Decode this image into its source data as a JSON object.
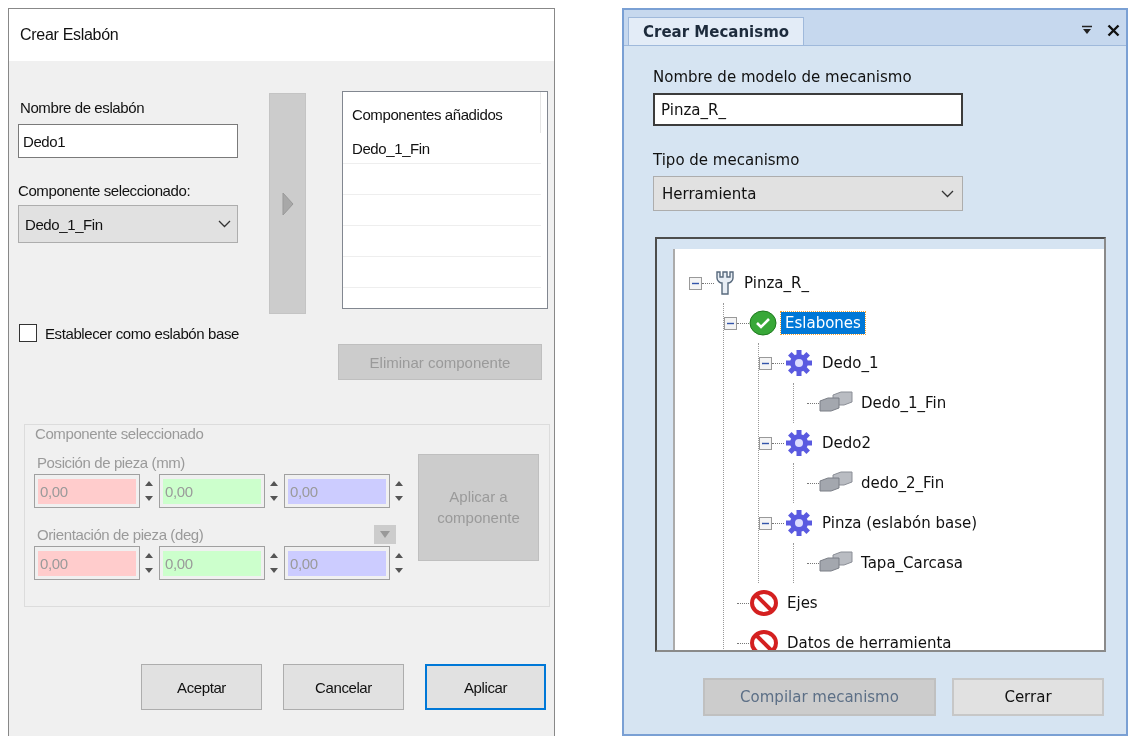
{
  "link_dialog": {
    "title": "Crear Eslabón",
    "name_label": "Nombre de eslabón",
    "name_value": "Dedo1",
    "component_label": "Componente seleccionado:",
    "component_value": "Dedo_1_Fin",
    "added_list": {
      "header": "Componentes añadidos",
      "rows": [
        "Dedo_1_Fin"
      ]
    },
    "base_checkbox": {
      "label": "Establecer como eslabón base",
      "checked": false
    },
    "remove_button": {
      "label": "Eliminar componente",
      "disabled": true
    },
    "group": {
      "title": "Componente seleccionado",
      "disabled": true,
      "position": {
        "label": "Posición de pieza (mm)",
        "fields": [
          {
            "value": "0,00",
            "color": "#ffcccc"
          },
          {
            "value": "0,00",
            "color": "#ccffcc"
          },
          {
            "value": "0,00",
            "color": "#ccccff"
          }
        ]
      },
      "orientation": {
        "label": "Orientación de pieza (deg)",
        "fields": [
          {
            "value": "0,00",
            "color": "#ffcccc"
          },
          {
            "value": "0,00",
            "color": "#ccffcc"
          },
          {
            "value": "0,00",
            "color": "#ccccff"
          }
        ]
      },
      "apply_button": "Aplicar a componente"
    },
    "buttons": [
      {
        "label": "Aceptar",
        "selected": false
      },
      {
        "label": "Cancelar",
        "selected": false
      },
      {
        "label": "Aplicar",
        "selected": true
      }
    ]
  },
  "mechanism_panel": {
    "tab": "Crear Mecanismo",
    "name_label": "Nombre de modelo de mecanismo",
    "name_value": "Pinza_R_",
    "type_label": "Tipo de mecanismo",
    "type_value": "Herramienta",
    "tree": [
      {
        "label": "Pinza_R_",
        "kind": "tool",
        "expanded": true,
        "selected": false,
        "children": [
          {
            "label": "Eslabones",
            "kind": "ok",
            "expanded": true,
            "selected": true,
            "children": [
              {
                "label": "Dedo_1",
                "kind": "link",
                "expanded": true,
                "selected": false,
                "children": [
                  {
                    "label": "Dedo_1_Fin",
                    "kind": "part",
                    "selected": false
                  }
                ]
              },
              {
                "label": "Dedo2",
                "kind": "link",
                "expanded": true,
                "selected": false,
                "children": [
                  {
                    "label": "dedo_2_Fin",
                    "kind": "part",
                    "selected": false
                  }
                ]
              },
              {
                "label": "Pinza (eslabón base)",
                "kind": "link",
                "expanded": true,
                "selected": false,
                "children": [
                  {
                    "label": "Tapa_Carcasa",
                    "kind": "part",
                    "selected": false
                  }
                ]
              }
            ]
          },
          {
            "label": "Ejes",
            "kind": "blocked",
            "selected": false
          },
          {
            "label": "Datos de herramienta",
            "kind": "blocked",
            "selected": false
          }
        ]
      }
    ],
    "buttons": [
      {
        "label": "Compilar mecanismo",
        "disabled": true
      },
      {
        "label": "Cerrar",
        "disabled": false
      }
    ]
  }
}
